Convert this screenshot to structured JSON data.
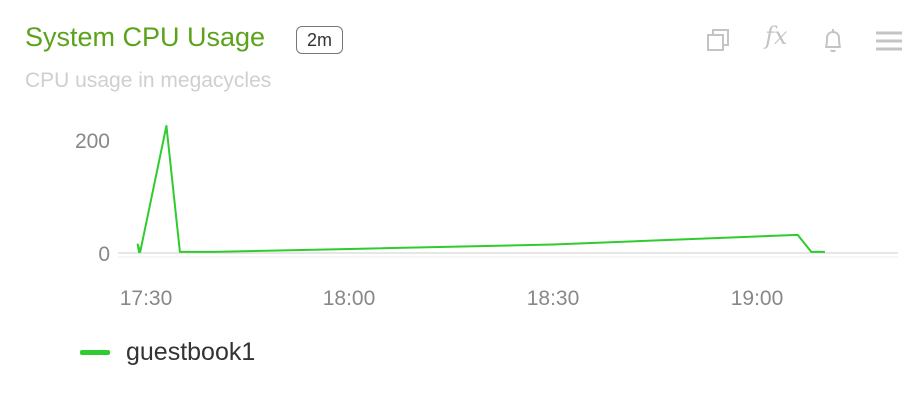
{
  "panel": {
    "title": "System CPU Usage",
    "badge": "2m",
    "subtitle": "CPU usage in megacycles",
    "tools": [
      "duplicate-icon",
      "fx-icon",
      "bell-icon",
      "menu-icon"
    ],
    "fx_text": "fx"
  },
  "colors": {
    "title": "#5aa31a",
    "series": "#2ecc2e",
    "axis": "#888888",
    "grid": "#dddddd",
    "icons": "#c4c4c4"
  },
  "chart_data": {
    "type": "line",
    "title": "System CPU Usage",
    "subtitle": "CPU usage in megacycles",
    "xlabel": "",
    "ylabel": "",
    "x_ticks": [
      "17:30",
      "18:00",
      "18:30",
      "19:00"
    ],
    "x_range": [
      "17:29",
      "19:11"
    ],
    "y_ticks": [
      0,
      200
    ],
    "ylim": [
      0,
      230
    ],
    "grid": false,
    "legend": "bottom-left",
    "series": [
      {
        "name": "guestbook1",
        "color": "#2ecc2e",
        "points": [
          [
            "17:29",
            0
          ],
          [
            "17:29",
            15
          ],
          [
            "17:29",
            2
          ],
          [
            "17:33",
            225
          ],
          [
            "17:35",
            2
          ],
          [
            "17:40",
            2
          ],
          [
            "18:00",
            7
          ],
          [
            "18:30",
            15
          ],
          [
            "19:06",
            32
          ],
          [
            "19:08",
            2
          ],
          [
            "19:10",
            2
          ]
        ]
      }
    ]
  }
}
